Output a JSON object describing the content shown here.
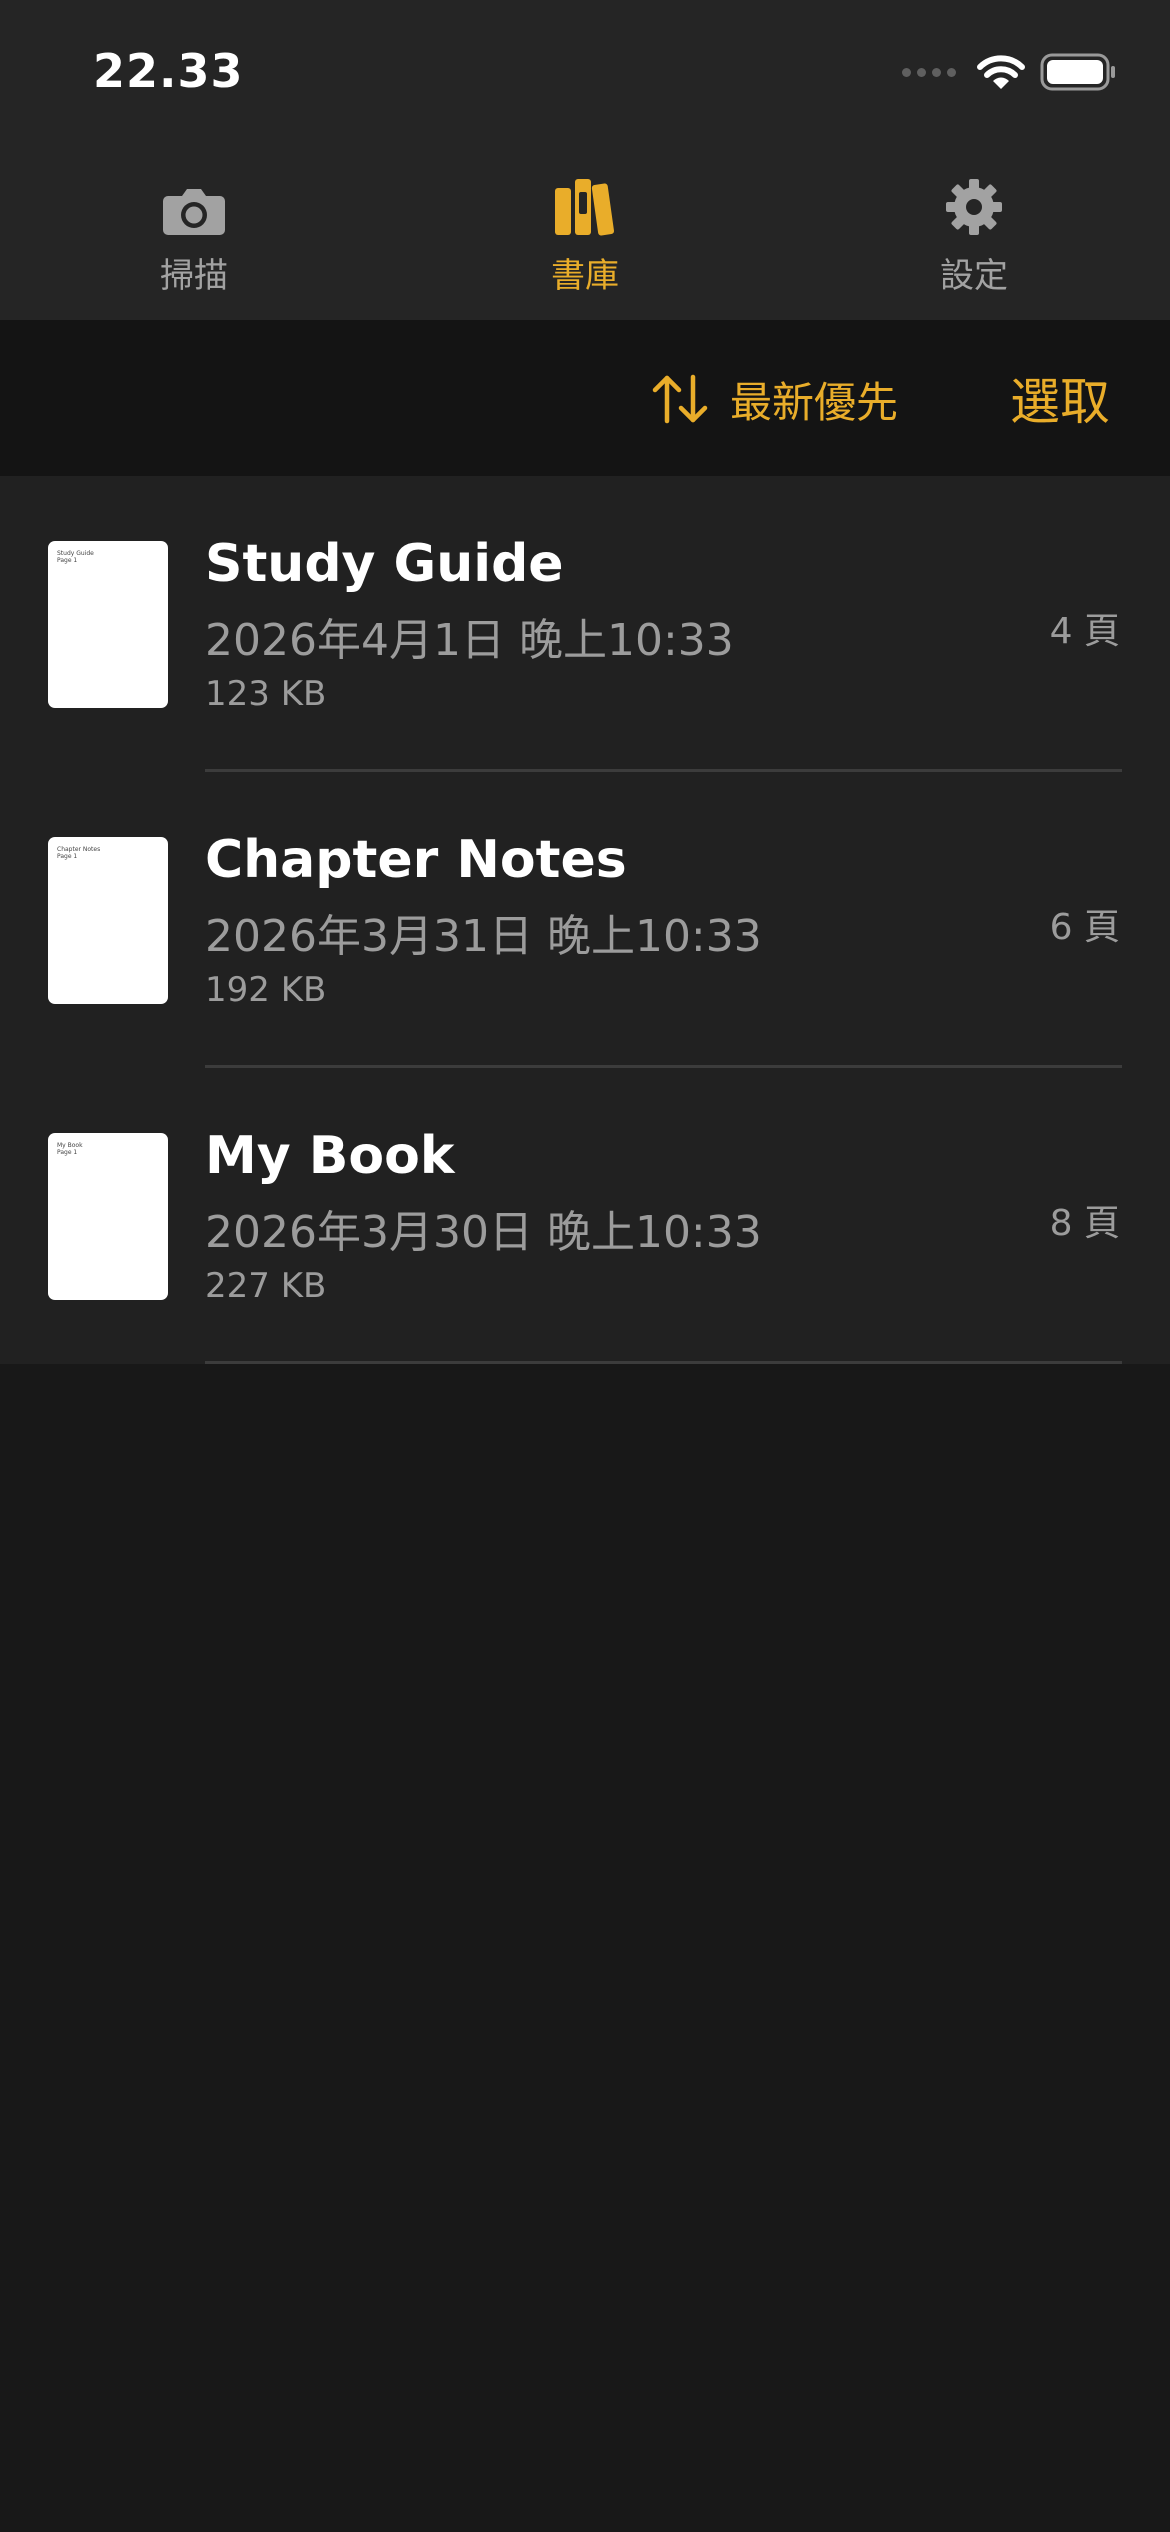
{
  "status_bar": {
    "time": "22.33"
  },
  "tabs": [
    {
      "label": "掃描",
      "icon": "camera-icon",
      "active": false
    },
    {
      "label": "書庫",
      "icon": "books-icon",
      "active": true
    },
    {
      "label": "設定",
      "icon": "gear-icon",
      "active": false
    }
  ],
  "toolbar": {
    "sort_label": "最新優先",
    "sort_icon": "sort-arrows-icon",
    "select_label": "選取"
  },
  "documents": [
    {
      "title": "Study Guide",
      "thumb_title": "Study Guide",
      "thumb_sub": "Page 1",
      "date": "2026年4月1日 晚上10:33",
      "size": "123 KB",
      "pages": "4 頁"
    },
    {
      "title": "Chapter Notes",
      "thumb_title": "Chapter Notes",
      "thumb_sub": "Page 1",
      "date": "2026年3月31日 晚上10:33",
      "size": "192 KB",
      "pages": "6 頁"
    },
    {
      "title": "My Book",
      "thumb_title": "My Book",
      "thumb_sub": "Page 1",
      "date": "2026年3月30日 晚上10:33",
      "size": "227 KB",
      "pages": "8 頁"
    }
  ],
  "colors": {
    "accent": "#e9ad2a",
    "background": "#181818",
    "list_background": "#212121",
    "header_background": "#252525",
    "secondary_text": "#9c9c9c"
  }
}
